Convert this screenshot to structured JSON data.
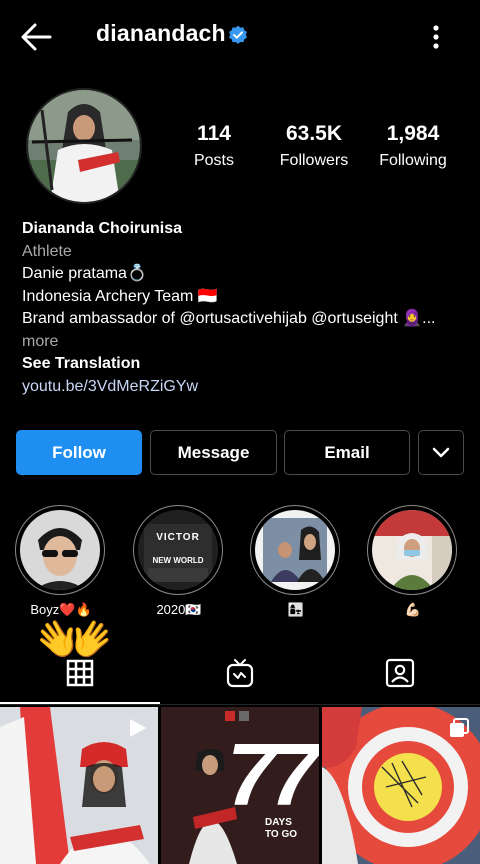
{
  "header": {
    "username": "dianandach",
    "back_icon": "arrow-left-icon",
    "verified_icon": "verified-badge-icon",
    "menu_icon": "more-vertical-icon"
  },
  "stats": [
    {
      "value": "114",
      "label": "Posts"
    },
    {
      "value": "63.5K",
      "label": "Followers"
    },
    {
      "value": "1,984",
      "label": "Following"
    }
  ],
  "bio": {
    "name": "Diananda Choirunisa",
    "category": "Athlete",
    "line1": "Danie pratama💍",
    "line2": "Indonesia Archery Team 🇮🇩",
    "line3": "Brand ambassador of @ortusactivehijab @ortuseight 🧕...",
    "more": "more",
    "see_translation": "See Translation",
    "link": "youtu.be/3VdMeRZiGYw"
  },
  "actions": {
    "follow": "Follow",
    "message": "Message",
    "email": "Email"
  },
  "highlights": [
    {
      "caption": "Boyz❤️🔥"
    },
    {
      "caption": "2020🇰🇷",
      "image_text_1": "VICTOR",
      "image_text_2": "NEW WORLD"
    },
    {
      "caption": "👩‍👧"
    },
    {
      "caption": "💪🏻"
    }
  ],
  "overlay": {
    "emoji": "👐"
  },
  "tabs": [
    {
      "name": "grid",
      "icon": "grid-icon",
      "active": true
    },
    {
      "name": "igtv",
      "icon": "igtv-icon",
      "active": false
    },
    {
      "name": "tagged",
      "icon": "tagged-user-icon",
      "active": false
    }
  ],
  "posts": [
    {
      "type": "video",
      "icon": "play-icon"
    },
    {
      "type": "image",
      "text_big": "77",
      "text_days": "DAYS",
      "text_togo": "TO GO"
    },
    {
      "type": "carousel",
      "icon": "carousel-icon"
    }
  ],
  "colors": {
    "accent": "#1f8ef1",
    "verified": "#3897f0",
    "background": "#000000"
  }
}
